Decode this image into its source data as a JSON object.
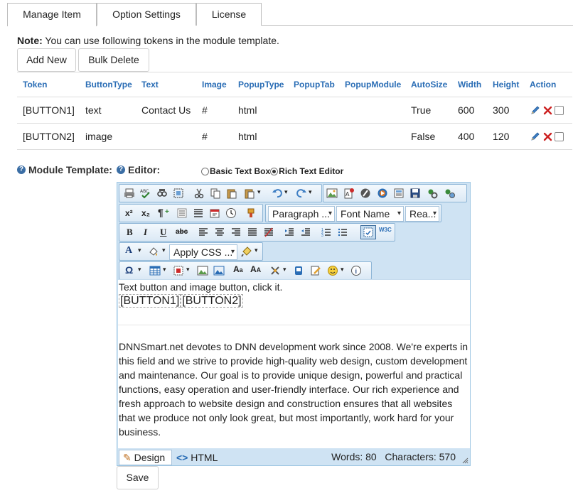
{
  "tabs": [
    {
      "label": "Manage Item",
      "active": true
    },
    {
      "label": "Option Settings",
      "active": false
    },
    {
      "label": "License",
      "active": false
    }
  ],
  "note": {
    "bold": "Note:",
    "text": " You can use following tokens in the module template."
  },
  "buttons": {
    "add_new": "Add New",
    "bulk_delete": "Bulk Delete",
    "save": "Save"
  },
  "table": {
    "headers": [
      "Token",
      "ButtonType",
      "Text",
      "Image",
      "PopupType",
      "PopupTab",
      "PopupModule",
      "AutoSize",
      "Width",
      "Height",
      "Action"
    ],
    "rows": [
      [
        "[BUTTON1]",
        "text",
        "Contact Us",
        "#",
        "html",
        "",
        "",
        "True",
        "600",
        "300"
      ],
      [
        "[BUTTON2]",
        "image",
        "",
        "#",
        "html",
        "",
        "",
        "False",
        "400",
        "120"
      ]
    ]
  },
  "module_template_label": "Module Template:",
  "editor_label": "Editor:",
  "editor_options": [
    {
      "label": "Basic Text Box",
      "selected": false
    },
    {
      "label": "Rich Text Editor",
      "selected": true
    }
  ],
  "toolbar": {
    "paragraph": "Paragraph ...",
    "font_name": "Font Name",
    "font_size": "Rea...",
    "apply_css": "Apply CSS ..."
  },
  "content": {
    "line1": "Text button and image button, click it.",
    "token1": "[BUTTON1]",
    "token2": "[BUTTON2]",
    "paragraph": "DNNSmart.net devotes to DNN development work since 2008. We're experts in this field and we strive to provide high-quality web design, custom development and maintenance. Our goal is to provide unique design, powerful and practical functions, easy operation and user-friendly interface. Our rich experience and fresh approach to website design and construction ensures that all websites that we produce not only look great, but most importantly, work hard for your business."
  },
  "status": {
    "design": "Design",
    "html": "HTML",
    "words": "Words: 80",
    "characters": "Characters: 570"
  },
  "colors": {
    "link_blue": "#2a6db5",
    "editor_bg": "#cfe3f3",
    "delete_red": "#cc1f1f"
  }
}
